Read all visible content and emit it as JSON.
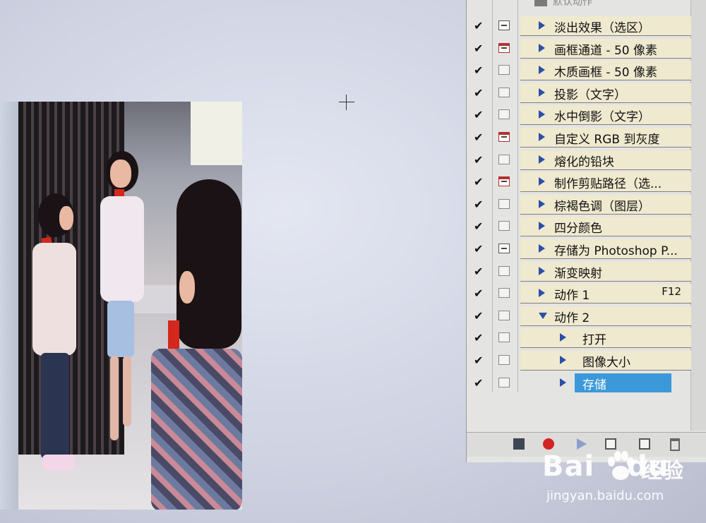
{
  "panel": {
    "set_name": "默认动作",
    "actions": [
      {
        "label": "淡出效果（选区）",
        "checked": true,
        "dialog": "on",
        "expand": "right",
        "indent": 0
      },
      {
        "label": "画框通道 - 50 像素",
        "checked": true,
        "dialog": "red",
        "expand": "right",
        "indent": 0
      },
      {
        "label": "木质画框 - 50 像素",
        "checked": true,
        "dialog": "off",
        "expand": "right",
        "indent": 0
      },
      {
        "label": "投影（文字）",
        "checked": true,
        "dialog": "off",
        "expand": "right",
        "indent": 0
      },
      {
        "label": "水中倒影（文字）",
        "checked": true,
        "dialog": "off",
        "expand": "right",
        "indent": 0
      },
      {
        "label": "自定义 RGB 到灰度",
        "checked": true,
        "dialog": "red",
        "expand": "right",
        "indent": 0
      },
      {
        "label": "熔化的铅块",
        "checked": true,
        "dialog": "off",
        "expand": "right",
        "indent": 0
      },
      {
        "label": "制作剪贴路径（选...",
        "checked": true,
        "dialog": "red",
        "expand": "right",
        "indent": 0
      },
      {
        "label": "棕褐色调（图层）",
        "checked": true,
        "dialog": "off",
        "expand": "right",
        "indent": 0
      },
      {
        "label": "四分颜色",
        "checked": true,
        "dialog": "off",
        "expand": "right",
        "indent": 0
      },
      {
        "label": "存储为 Photoshop P...",
        "checked": true,
        "dialog": "on",
        "expand": "right",
        "indent": 0
      },
      {
        "label": "渐变映射",
        "checked": true,
        "dialog": "off",
        "expand": "right",
        "indent": 0
      },
      {
        "label": "动作 1",
        "checked": true,
        "dialog": "off",
        "expand": "right",
        "indent": 0,
        "shortcut": "F12"
      },
      {
        "label": "动作 2",
        "checked": true,
        "dialog": "off",
        "expand": "down",
        "indent": 0
      },
      {
        "label": "打开",
        "checked": true,
        "dialog": "off",
        "expand": "right",
        "indent": 1
      },
      {
        "label": "图像大小",
        "checked": true,
        "dialog": "off",
        "expand": "right",
        "indent": 1
      },
      {
        "label": "存储",
        "checked": true,
        "dialog": "off",
        "expand": "right",
        "indent": 1,
        "selected": true
      }
    ],
    "check_glyph": "✔"
  },
  "toolbar": {
    "icons": [
      "stop-icon",
      "record-icon",
      "play-icon",
      "new-set-icon",
      "new-action-icon",
      "trash-icon"
    ]
  },
  "watermark": {
    "brand": "Bai",
    "brand_suffix": "du",
    "product": "经验",
    "url": "jingyan.baidu.com"
  },
  "colors": {
    "selection": "#3c98d8",
    "action_bg": "#efe9cf",
    "triangle": "#2b4fa8",
    "record": "#d32424"
  }
}
